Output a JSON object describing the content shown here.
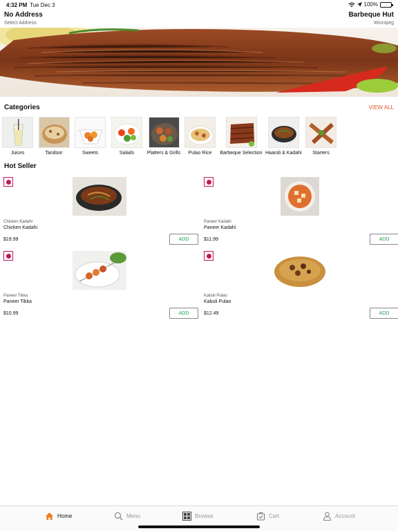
{
  "status_bar": {
    "time": "4:32 PM",
    "date": "Tue Dec 3",
    "battery": "100%"
  },
  "header": {
    "address_title": "No Address",
    "address_sub": "Select Address",
    "store_title": "Barbeque Hut",
    "store_sub": "Winnipeg"
  },
  "banner": {
    "slide_count": 2,
    "active_slide": 1
  },
  "categories": {
    "title": "Categories",
    "view_all": "VIEW ALL",
    "items": [
      {
        "label": "Juices"
      },
      {
        "label": "Tandoor"
      },
      {
        "label": "Sweets"
      },
      {
        "label": "Salads"
      },
      {
        "label": "Platters & Grills"
      },
      {
        "label": "Pulao Rice"
      },
      {
        "label": "Barbeque Selection"
      },
      {
        "label": "Haandi & Kadahi"
      },
      {
        "label": "Starters"
      }
    ]
  },
  "hot_seller": {
    "title": "Hot Seller",
    "add_label": "ADD",
    "items": [
      {
        "small": "Chicken Kadahi",
        "name": "Chicken Kadahi",
        "price": "$19.99"
      },
      {
        "small": "Paneer Kadahi",
        "name": "Paneer Kadahi",
        "price": "$11.99"
      },
      {
        "small": "Paneer Tikka",
        "name": "Paneer Tikka",
        "price": "$10.99"
      },
      {
        "small": "Kabuli Pulao",
        "name": "Kabuli Pulao",
        "price": "$12.49"
      }
    ]
  },
  "tabs": [
    {
      "label": "Home",
      "icon": "home-icon",
      "active": true
    },
    {
      "label": "Menu",
      "icon": "search-icon",
      "active": false
    },
    {
      "label": "Browse",
      "icon": "grid-icon",
      "active": false
    },
    {
      "label": "Cart",
      "icon": "cart-icon",
      "active": false
    },
    {
      "label": "Account",
      "icon": "user-icon",
      "active": false
    }
  ],
  "colors": {
    "accent": "#e0582a",
    "veg_mark": "#c2185b",
    "add_text": "#1aa34a",
    "home_icon": "#f07b1d"
  }
}
